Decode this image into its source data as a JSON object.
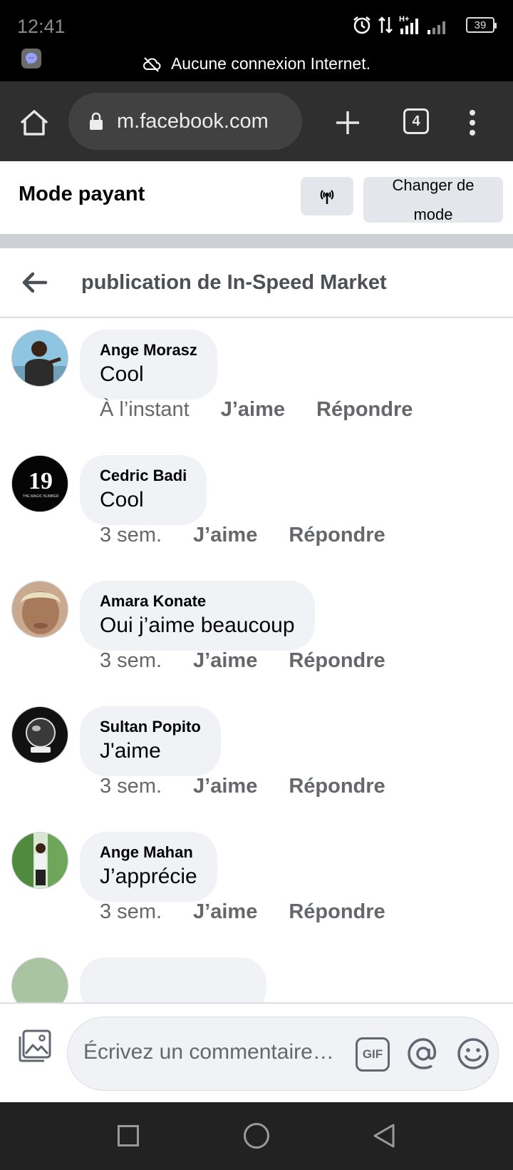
{
  "status_bar": {
    "time": "12:41",
    "battery": "39",
    "network": "H+",
    "offline_message": "Aucune connexion Internet."
  },
  "browser": {
    "url": "m.facebook.com",
    "tab_count": "4"
  },
  "mode": {
    "title": "Mode payant",
    "change_line1": "Changer de",
    "change_line2": "mode"
  },
  "post": {
    "title": "publication de In-Speed Market"
  },
  "comments": [
    {
      "name": "Ange Morasz",
      "text": "Cool",
      "time": "À l’instant",
      "like": "J’aime",
      "reply": "Répondre"
    },
    {
      "name": "Cedric Badi",
      "text": "Cool",
      "time": "3 sem.",
      "like": "J’aime",
      "reply": "Répondre",
      "avatar_text": "19",
      "avatar_subtext": "THE MAGIC NUMBER"
    },
    {
      "name": "Amara Konate",
      "text": "Oui j’aime beaucoup",
      "time": "3 sem.",
      "like": "J’aime",
      "reply": "Répondre"
    },
    {
      "name": "Sultan Popito",
      "text": "J'aime",
      "time": "3 sem.",
      "like": "J’aime",
      "reply": "Répondre"
    },
    {
      "name": "Ange Mahan",
      "text": "J’apprécie",
      "time": "3 sem.",
      "like": "J’aime",
      "reply": "Répondre"
    }
  ],
  "composer": {
    "placeholder": "Écrivez un commentaire…",
    "gif_label": "GIF"
  },
  "colors": {
    "bubble": "#f0f2f5",
    "secondary_text": "#65676b",
    "browser_bar": "#2f2f2f",
    "separator": "#cdd0d4"
  },
  "icons": [
    "home-icon",
    "lock-icon",
    "plus-icon",
    "tabs-icon",
    "more-icon",
    "broadcast-icon",
    "back-arrow-icon",
    "photo-icon",
    "gif-icon",
    "mention-icon",
    "emoji-icon",
    "cloud-off-icon",
    "alarm-icon",
    "signal-icon",
    "battery-icon"
  ]
}
